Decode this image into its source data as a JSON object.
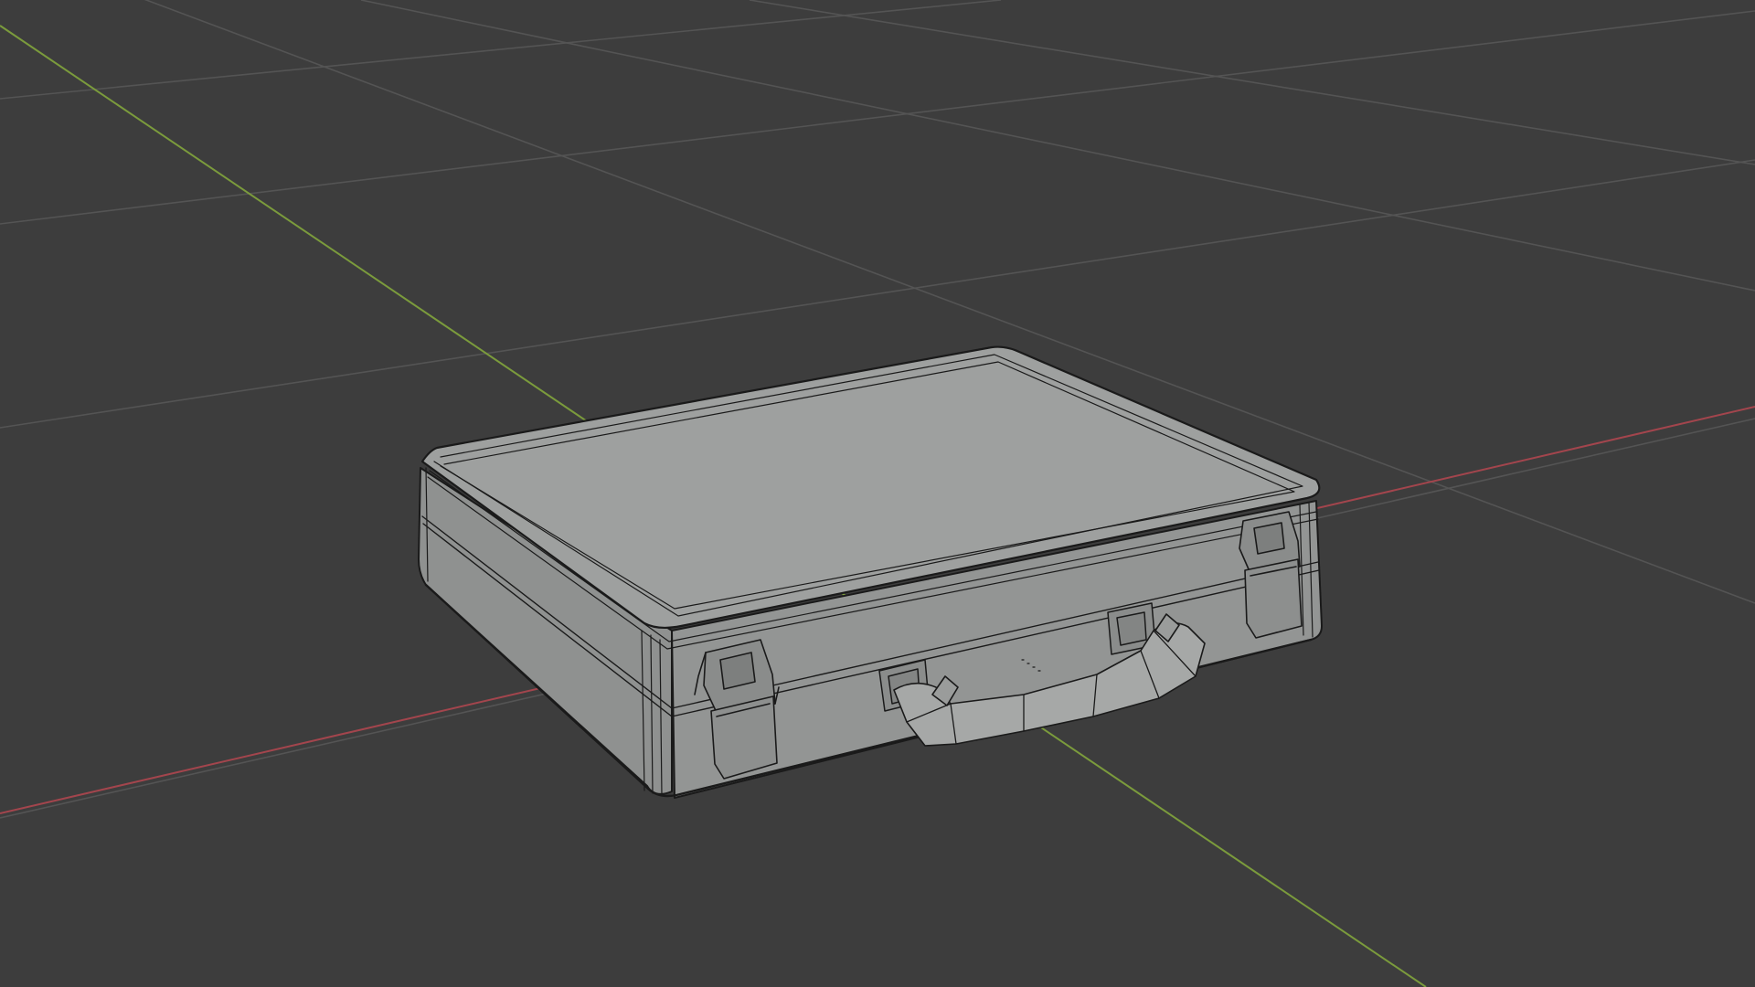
{
  "viewport": {
    "shading": "solid-with-wireframe",
    "background_color": "#3d3d3d",
    "grid_color": "#545454",
    "x_axis_color": "#a3454d",
    "y_axis_color": "#7b9b3c",
    "object_color": "#9ea09f",
    "wire_color": "#1a1a1a"
  },
  "object": {
    "kind": "briefcase",
    "parts": [
      "case-body",
      "lid-top",
      "latch-left",
      "latch-right",
      "handle",
      "handle-mount-left",
      "handle-mount-right"
    ]
  }
}
